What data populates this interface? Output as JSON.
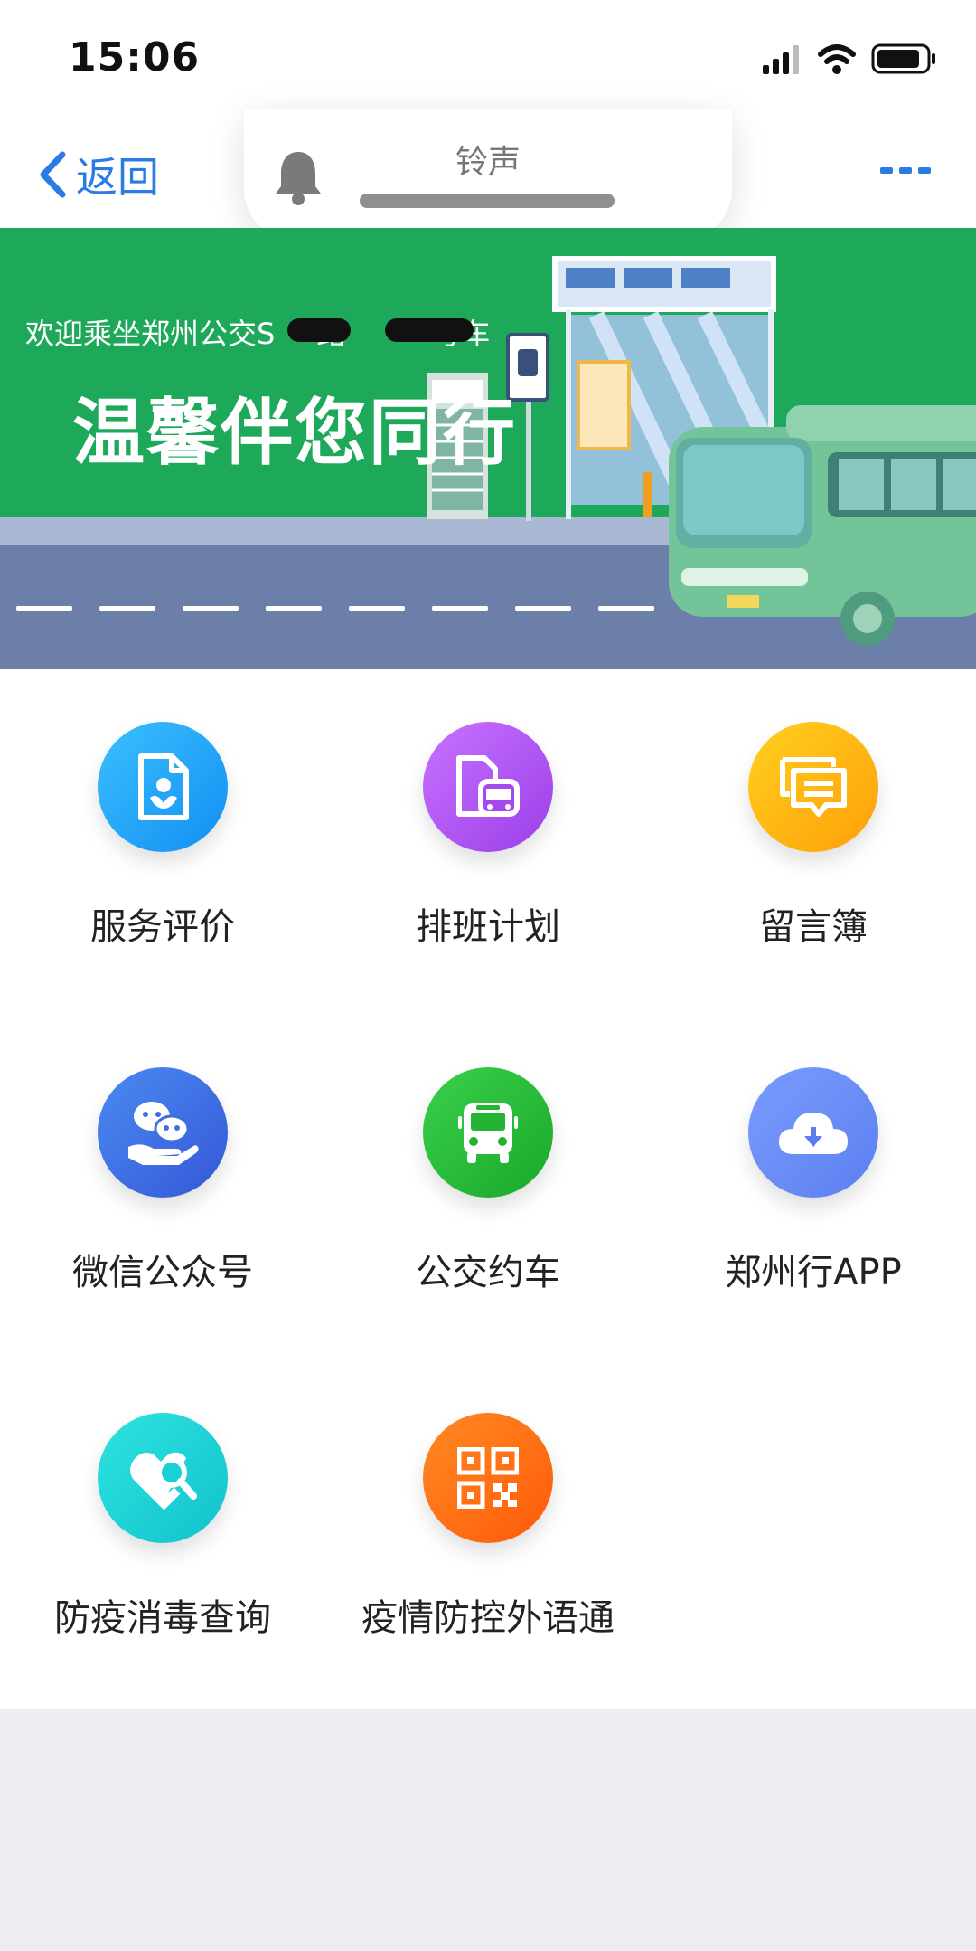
{
  "status_bar": {
    "time": "15:06"
  },
  "nav": {
    "back_label": "返回"
  },
  "ringtone": {
    "label": "铃声"
  },
  "banner": {
    "welcome_text": "欢迎乘坐郑州公交S",
    "welcome_text_2": "路",
    "welcome_text_3": "号车",
    "slogan": "温馨伴您同行"
  },
  "menu": {
    "items": [
      {
        "label": "服务评价",
        "icon": "flower-document-icon",
        "color": "#1aa3f7"
      },
      {
        "label": "排班计划",
        "icon": "bus-document-icon",
        "color": "#b04ef0"
      },
      {
        "label": "留言簿",
        "icon": "message-icon",
        "color": "#ffb109"
      },
      {
        "label": "微信公众号",
        "icon": "wechat-hand-icon",
        "color": "#3f6fe5"
      },
      {
        "label": "公交约车",
        "icon": "bus-icon",
        "color": "#27bd33"
      },
      {
        "label": "郑州行APP",
        "icon": "cloud-download-icon",
        "color": "#6c8ff5"
      },
      {
        "label": "防疫消毒查询",
        "icon": "heart-search-icon",
        "color": "#1dd6d6"
      },
      {
        "label": "疫情防控外语通",
        "icon": "qr-code-icon",
        "color": "#ff6a12"
      }
    ]
  }
}
